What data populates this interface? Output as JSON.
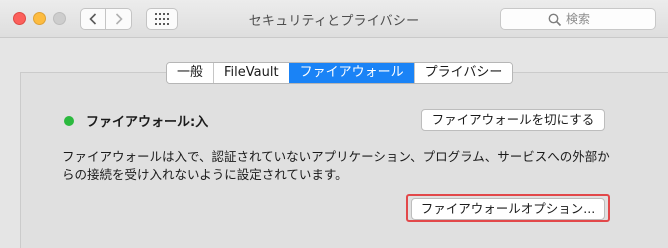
{
  "window": {
    "title": "セキュリティとプライバシー"
  },
  "search": {
    "placeholder": "検索"
  },
  "tabs": [
    {
      "label": "一般"
    },
    {
      "label": "FileVault"
    },
    {
      "label": "ファイアウォール",
      "active": true
    },
    {
      "label": "プライバシー"
    }
  ],
  "firewall": {
    "status_label": "ファイアウォール:入",
    "status_color": "#2bb93e",
    "turn_off_button": "ファイアウォールを切にする",
    "description": "ファイアウォールは入で、認証されていないアプリケーション、プログラム、サービスへの外部からの接続を受け入れないように設定されています。",
    "options_button": "ファイアウォールオプション..."
  },
  "icons": {
    "back": "chevron-left-icon",
    "forward": "chevron-right-icon",
    "grid": "grid-icon",
    "search": "search-icon"
  },
  "colors": {
    "accent": "#1a83f6",
    "highlight": "#e2484a"
  }
}
